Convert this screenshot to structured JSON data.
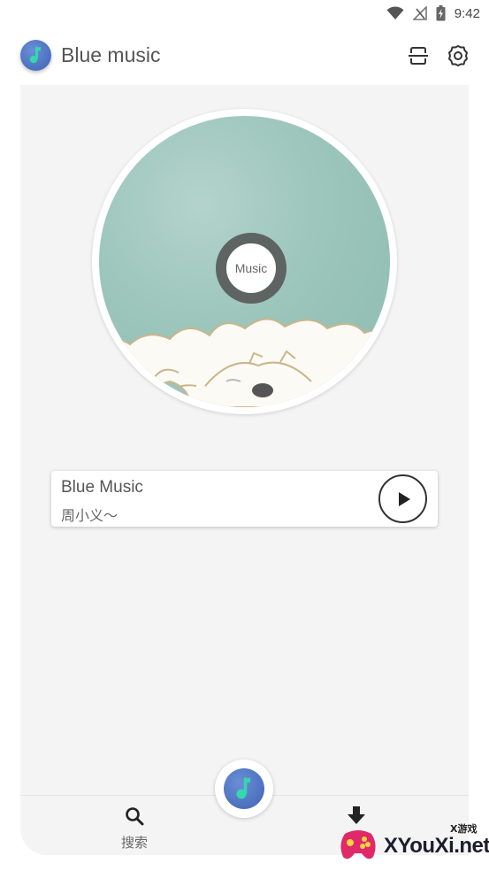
{
  "status_bar": {
    "time": "9:42",
    "icons": [
      "wifi-icon",
      "no-signal-icon",
      "battery-charging-icon"
    ]
  },
  "app_bar": {
    "title": "Blue music",
    "actions": [
      "scan-icon",
      "settings-gear-icon"
    ]
  },
  "disc": {
    "center_label": "Music"
  },
  "now_playing": {
    "title": "Blue Music",
    "artist": "周小义～",
    "play_icon": "play-icon"
  },
  "bottom_nav": {
    "search_label": "搜索",
    "center_icon": "music-note-icon",
    "right_icon": "download-icon"
  },
  "watermark": {
    "text": "XYouXi.net",
    "small_text": "X游戏"
  },
  "colors": {
    "accent_blue": "#3f63b5",
    "note_green": "#35d6b0",
    "panel_bg": "#f4f4f4",
    "disc_teal": "#9cc5bb"
  }
}
